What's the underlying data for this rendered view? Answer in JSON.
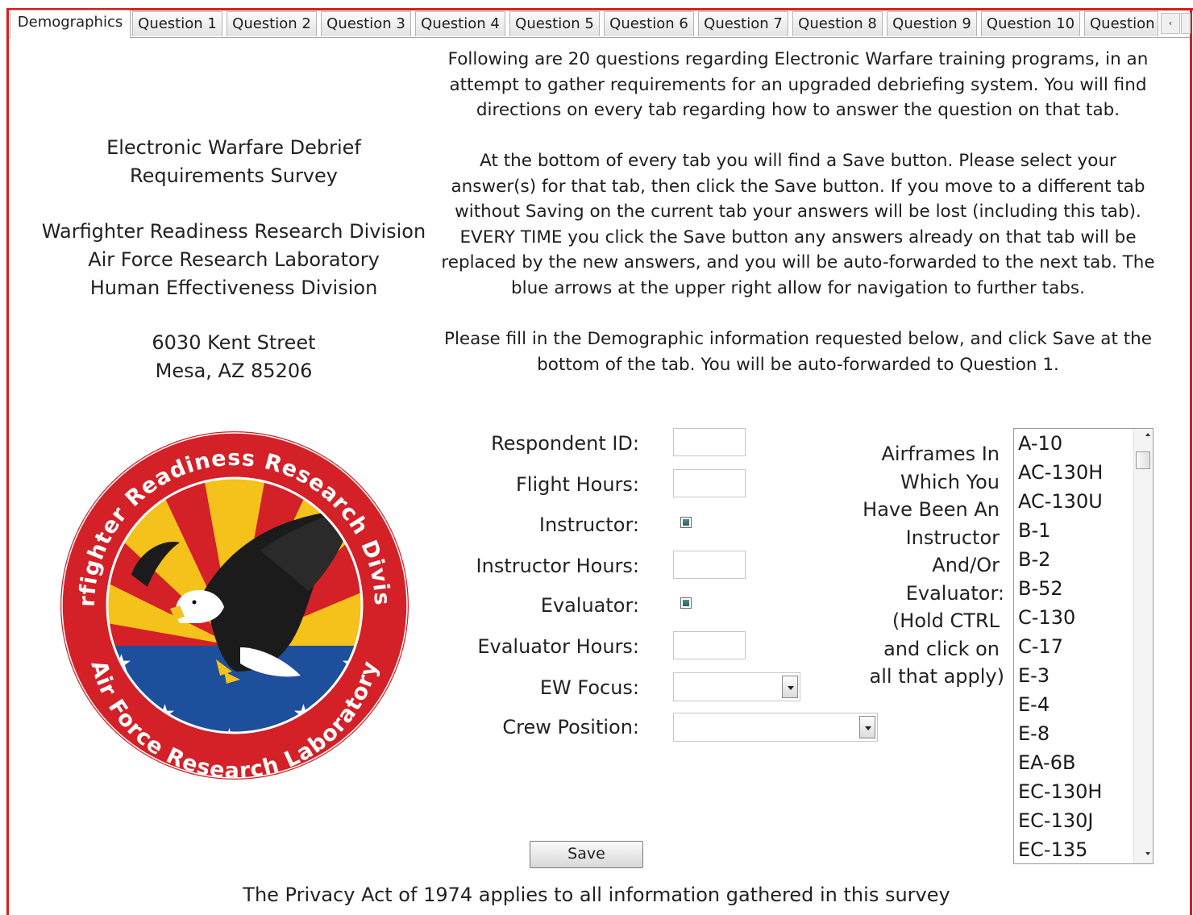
{
  "tabs": [
    {
      "label": "Demographics",
      "active": true
    },
    {
      "label": "Question 1"
    },
    {
      "label": "Question 2"
    },
    {
      "label": "Question 3"
    },
    {
      "label": "Question 4"
    },
    {
      "label": "Question 5"
    },
    {
      "label": "Question 6"
    },
    {
      "label": "Question 7"
    },
    {
      "label": "Question 8"
    },
    {
      "label": "Question 9"
    },
    {
      "label": "Question 10"
    },
    {
      "label": "Question"
    }
  ],
  "tab_nav": {
    "prev_icon": "‹"
  },
  "left": {
    "title_line1": "Electronic Warfare Debrief",
    "title_line2": "Requirements Survey",
    "org_line1": "Warfighter Readiness Research Division",
    "org_line2": "Air Force Research Laboratory",
    "org_line3": "Human Effectiveness Division",
    "address_line1": "6030 Kent Street",
    "address_line2": "Mesa, AZ  85206"
  },
  "logo": {
    "top_text": "Warfighter Readiness Research Division",
    "bottom_text": "Air Force Research Laboratory"
  },
  "instructions": {
    "p1": [
      "Following are 20 questions regarding Electronic Warfare training programs, in an",
      "attempt to gather requirements for an upgraded debriefing system.  You will find",
      "directions on every tab regarding how to answer the question on that tab."
    ],
    "p2": [
      "At the bottom of every tab you will find a Save button.  Please select your",
      "answer(s) for that tab, then click the Save button.  If you move to a different tab",
      "without Saving on the current tab your answers will be lost (including this tab).",
      "EVERY TIME you click the Save button any answers already on that tab will be",
      "replaced by the new answers, and you will be auto-forwarded to the next tab.  The",
      "blue arrows at the upper right allow for navigation to further tabs."
    ],
    "p3": [
      "Please fill in the Demographic information requested below,  and click Save at the",
      "bottom of the tab.  You will be auto-forwarded to Question 1."
    ]
  },
  "form": {
    "respondent_id_label": "Respondent ID:",
    "flight_hours_label": "Flight Hours:",
    "instructor_label": "Instructor:",
    "instructor_hours_label": "Instructor Hours:",
    "evaluator_label": "Evaluator:",
    "evaluator_hours_label": "Evaluator Hours:",
    "ew_focus_label": "EW Focus:",
    "crew_position_label": "Crew Position:",
    "respondent_id_value": "",
    "flight_hours_value": "",
    "instructor_hours_value": "",
    "evaluator_hours_value": "",
    "ew_focus_value": "",
    "crew_position_value": ""
  },
  "airframes": {
    "label_lines": [
      "Airframes In",
      "Which You",
      "Have Been An",
      "Instructor",
      "And/Or",
      "Evaluator:",
      "(Hold CTRL",
      "and click on",
      "all that apply)"
    ],
    "options": [
      "A-10",
      "AC-130H",
      "AC-130U",
      "B-1",
      "B-2",
      "B-52",
      "C-130",
      "C-17",
      "E-3",
      "E-4",
      "E-8",
      "EA-6B",
      "EC-130H",
      "EC-130J",
      "EC-135"
    ]
  },
  "save_label": "Save",
  "privacy_text": "The Privacy Act of 1974 applies to all information gathered in this survey",
  "colors": {
    "frame_red": "#d51f1f",
    "seal_red": "#d42027",
    "seal_blue": "#1d4f9c",
    "seal_yellow": "#f4c21a"
  }
}
